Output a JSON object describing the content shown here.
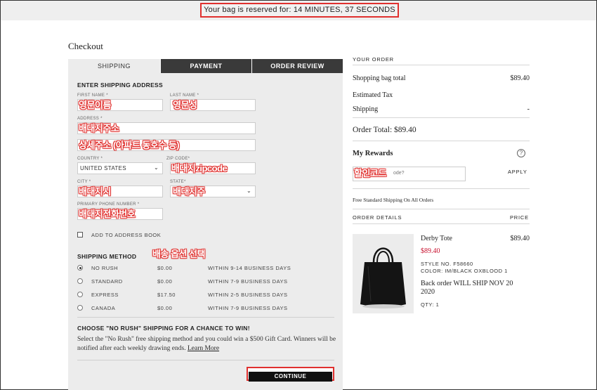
{
  "timer": {
    "text": "Your bag is reserved for: 14 MINUTES, 37 SECONDS"
  },
  "page_title": "Checkout",
  "tabs": {
    "shipping": "SHIPPING",
    "payment": "PAYMENT",
    "review": "ORDER REVIEW"
  },
  "shipping_address": {
    "title": "ENTER SHIPPING ADDRESS",
    "first_name_label": "FIRST NAME *",
    "first_name_value": "영문이름",
    "last_name_label": "LAST NAME *",
    "last_name_value": "영문성",
    "address_label": "ADDRESS *",
    "address_value": "배대지주소",
    "address2_value": "상세주소 (아파트 동호수 등)",
    "country_label": "COUNTRY *",
    "country_value": "UNITED STATES",
    "zip_label": "ZIP CODE*",
    "zip_value": "배대지zipcode",
    "city_label": "CITY *",
    "city_value": "배대지시",
    "state_label": "STATE*",
    "state_value": "배대지주",
    "phone_label": "PRIMARY PHONE NUMBER *",
    "phone_value": "배대지전화번호",
    "add_to_book": "ADD TO ADDRESS BOOK"
  },
  "shipping_method": {
    "title": "SHIPPING METHOD",
    "annotation": "배송 옵션 선택",
    "options": [
      {
        "name": "NO RUSH",
        "price": "$0.00",
        "eta": "WITHIN 9-14 BUSINESS DAYS",
        "selected": true
      },
      {
        "name": "STANDARD",
        "price": "$0.00",
        "eta": "WITHIN 7-9 BUSINESS DAYS",
        "selected": false
      },
      {
        "name": "EXPRESS",
        "price": "$17.50",
        "eta": "WITHIN 2-5 BUSINESS DAYS",
        "selected": false
      },
      {
        "name": "CANADA",
        "price": "$0.00",
        "eta": "WITHIN 7-9 BUSINESS DAYS",
        "selected": false
      }
    ]
  },
  "promo": {
    "title": "CHOOSE \"NO RUSH\" SHIPPING FOR A CHANCE TO WIN!",
    "body": "Select the \"No Rush\" free shipping method and you could win a $500 Gift Card. Winners will be notified after each weekly drawing ends.",
    "link": "Learn More"
  },
  "continue_label": "CONTINUE",
  "order": {
    "title": "YOUR ORDER",
    "bag_total_label": "Shopping bag total",
    "bag_total_value": "$89.40",
    "tax_label": "Estimated Tax",
    "shipping_label": "Shipping",
    "shipping_value": "-",
    "total": "Order Total: $89.40"
  },
  "rewards": {
    "title": "My Rewards",
    "help_icon": "?",
    "promo_placeholder": "ode?",
    "promo_annotation": "할인코드",
    "apply_label": "APPLY",
    "free_shipping": "Free Standard Shipping On All Orders"
  },
  "details": {
    "title": "ORDER DETAILS",
    "price_header": "PRICE",
    "product_name": "Derby Tote",
    "product_price": "$89.40",
    "sale_price": "$89.40",
    "style": "STYLE NO. F58660",
    "color": "COLOR: IM/BLACK OXBLOOD 1",
    "backorder": "Back order WILL SHIP NOV 20 2020",
    "qty": "QTY: 1"
  },
  "colors": {
    "accent_red": "#e0302e",
    "tab_dark": "#3a3a3a",
    "panel": "#ececec",
    "sale_red": "#c8102e"
  }
}
